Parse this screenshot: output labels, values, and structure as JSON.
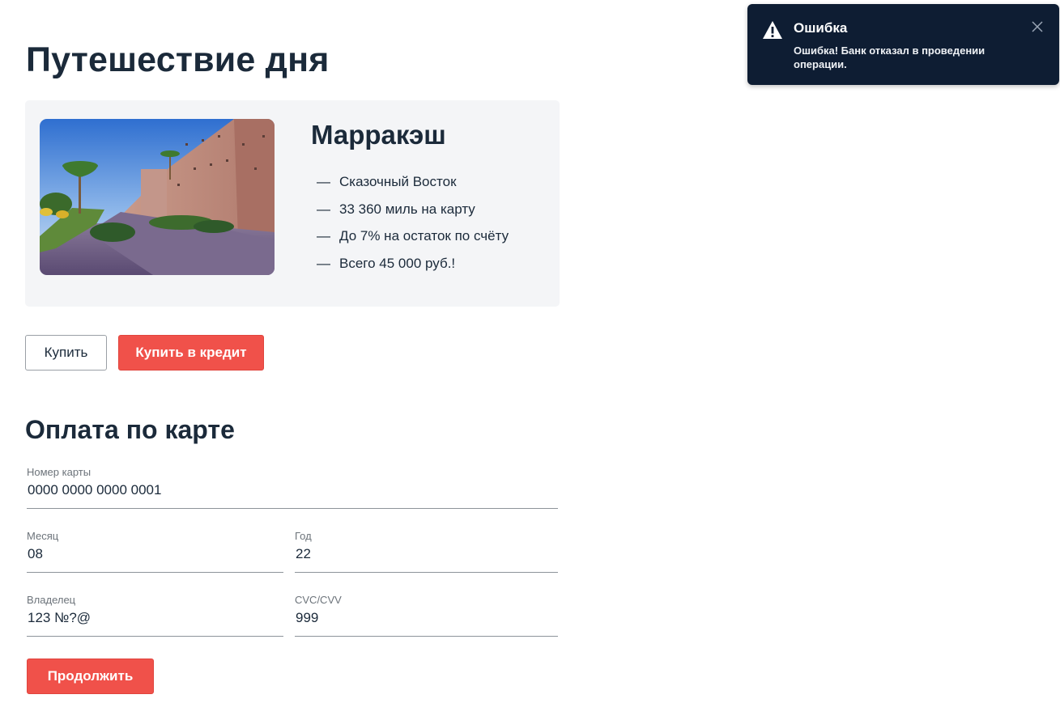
{
  "page": {
    "title": "Путешествие дня"
  },
  "offer": {
    "city": "Марракэш",
    "image_subject": "marrakesh-city-wall-photo",
    "features": [
      "Сказочный Восток",
      "33 360 миль на карту",
      "До 7% на остаток по счёту",
      "Всего 45 000 руб.!"
    ],
    "dash": "—"
  },
  "actions": {
    "buy_label": "Купить",
    "credit_label": "Купить в кредит"
  },
  "payment": {
    "title": "Оплата по карте",
    "card_number": {
      "label": "Номер карты",
      "value": "0000 0000 0000 0001"
    },
    "month": {
      "label": "Месяц",
      "value": "08"
    },
    "year": {
      "label": "Год",
      "value": "22"
    },
    "owner": {
      "label": "Владелец",
      "value": "123 №?@"
    },
    "cvc": {
      "label": "CVC/CVV",
      "value": "999"
    },
    "continue_label": "Продолжить"
  },
  "notification": {
    "title": "Ошибка",
    "message": "Ошибка! Банк отказал в проведении операции.",
    "icon": "warning-icon",
    "close_icon": "close-icon"
  },
  "colors": {
    "accent": "#f0514a",
    "text": "#1b2a3a",
    "card_bg": "#f4f5f7",
    "toast_bg": "#0e1d33"
  }
}
